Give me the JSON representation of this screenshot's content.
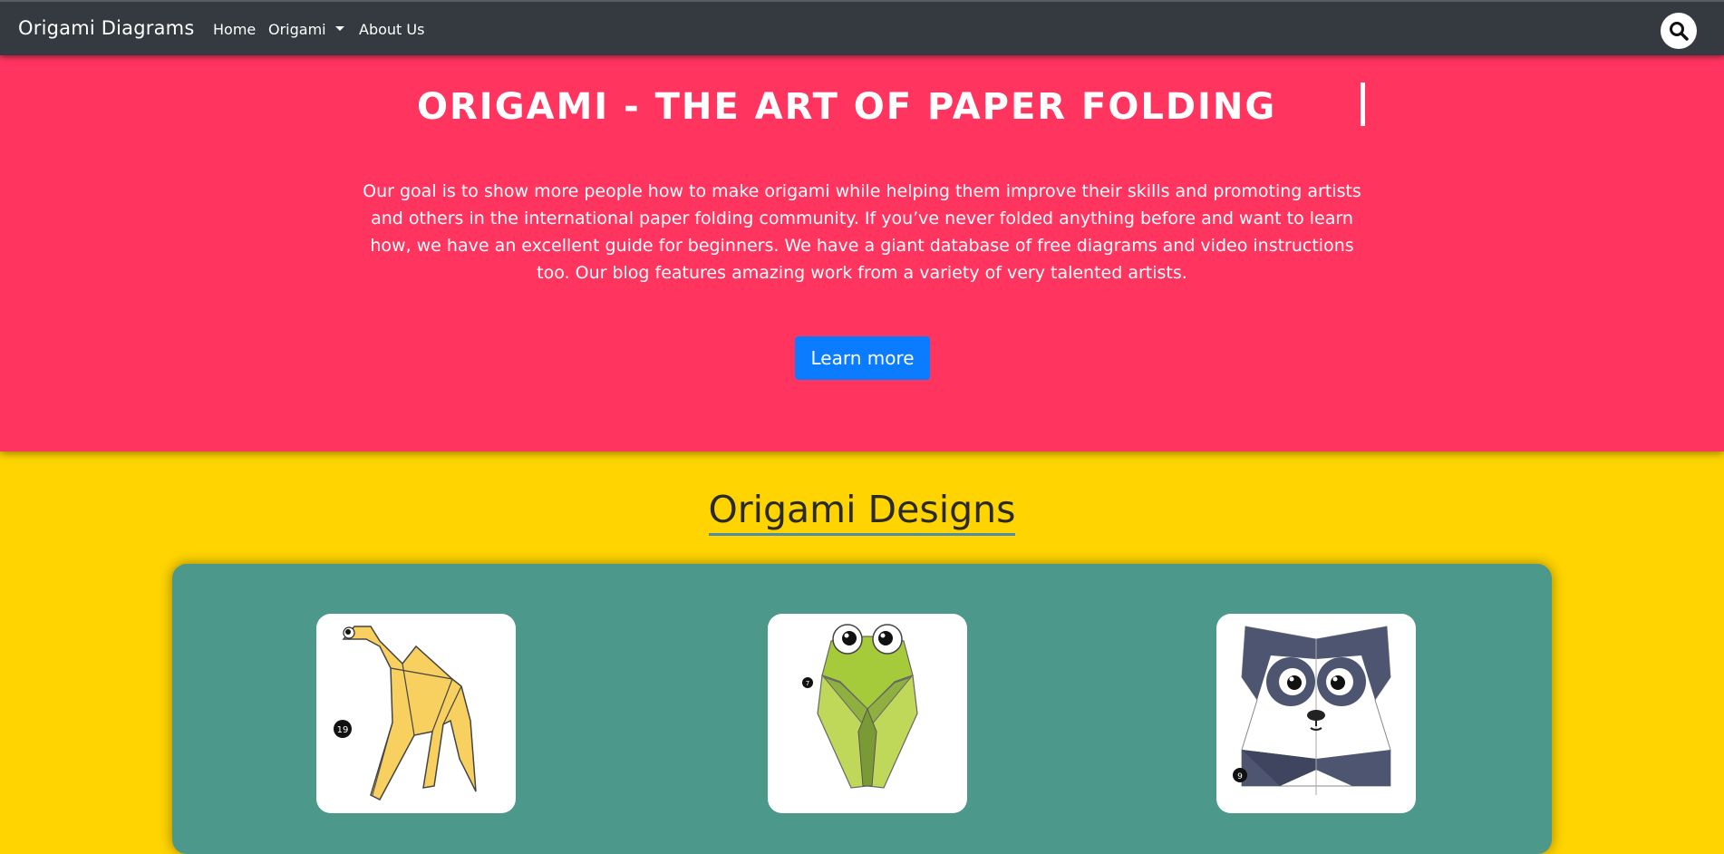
{
  "navbar": {
    "brand": "Origami Diagrams",
    "links": [
      {
        "label": "Home"
      },
      {
        "label": "Origami"
      },
      {
        "label": "About Us"
      }
    ],
    "search_icon": "search-icon"
  },
  "hero": {
    "title": "ORIGAMI - THE ART OF PAPER FOLDING",
    "description": "Our goal is to show more people how to make origami while helping them improve their skills and promoting artists and others in the international paper folding community. If you’ve never folded anything before and want to learn how, we have an excellent guide for beginners. We have a giant database of free diagrams and video instructions too. Our blog features amazing work from a variety of very talented artists.",
    "button_label": "Learn more"
  },
  "designs": {
    "title": "Origami Designs",
    "cards": [
      {
        "icon": "camel-origami-icon",
        "step": "19"
      },
      {
        "icon": "cicada-origami-icon",
        "step": "7"
      },
      {
        "icon": "panda-origami-icon",
        "step": "9"
      }
    ]
  },
  "colors": {
    "navbar_bg": "#343a40",
    "hero_bg": "#ff3560",
    "page_bg": "#ffd400",
    "panel_bg": "#4c998c",
    "button_bg": "#0b7bff"
  }
}
